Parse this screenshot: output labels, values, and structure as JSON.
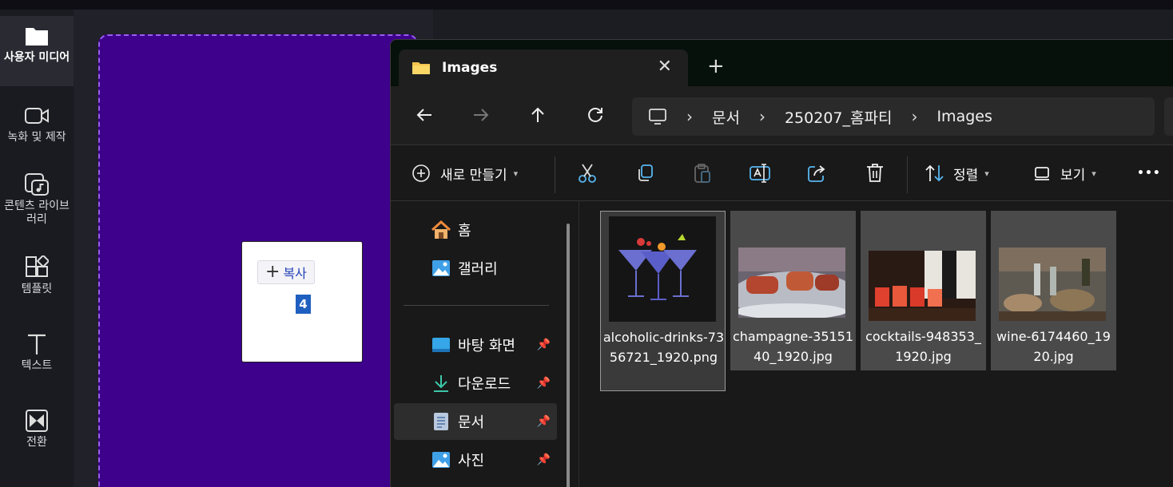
{
  "editor_sidebar": {
    "items": [
      {
        "label": "사용자 미디어",
        "icon": "folder-icon"
      },
      {
        "label": "녹화 및 제작",
        "icon": "camera-icon"
      },
      {
        "label": "콘텐츠 라이브러리",
        "icon": "library-icon"
      },
      {
        "label": "템플릿",
        "icon": "template-icon"
      },
      {
        "label": "텍스트",
        "icon": "text-icon"
      },
      {
        "label": "전환",
        "icon": "transition-icon"
      }
    ]
  },
  "canvas": {
    "copy_button": "복사",
    "badge": "4",
    "background_color": "#3d018c",
    "border_color": "#9a5cf0"
  },
  "explorer": {
    "tab_title": "Images",
    "new_tab": "+",
    "breadcrumb": [
      "문서",
      "250207_홈파티",
      "Images"
    ],
    "toolbar": {
      "new_label": "새로 만들기",
      "sort_label": "정렬",
      "view_label": "보기",
      "more_label": "•••"
    },
    "nav": {
      "items": [
        {
          "label": "홈",
          "icon": "home-icon"
        },
        {
          "label": "갤러리",
          "icon": "gallery-icon"
        },
        {
          "label": "바탕 화면",
          "icon": "desktop-icon",
          "pinned": true
        },
        {
          "label": "다운로드",
          "icon": "download-icon",
          "pinned": true
        },
        {
          "label": "문서",
          "icon": "document-icon",
          "pinned": true,
          "selected": true
        },
        {
          "label": "사진",
          "icon": "pictures-icon",
          "pinned": true
        }
      ]
    },
    "files": [
      {
        "name": "alcoholic-drinks-7356721_1920.png",
        "selected": true
      },
      {
        "name": "champagne-3515140_1920.jpg",
        "selected": false
      },
      {
        "name": "cocktails-948353_1920.jpg",
        "selected": false
      },
      {
        "name": "wine-6174460_1920.jpg",
        "selected": false
      }
    ]
  }
}
